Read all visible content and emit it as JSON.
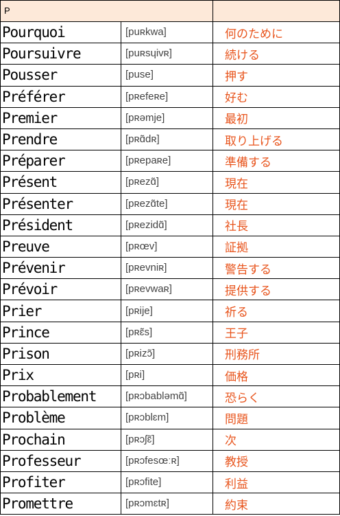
{
  "header": {
    "letter": "P"
  },
  "entries": [
    {
      "word": "Pourquoi",
      "pron": "[puʀkwa]",
      "ja": "何のために"
    },
    {
      "word": "Poursuivre",
      "pron": "[puʀsɥivʀ]",
      "ja": "続ける"
    },
    {
      "word": "Pousser",
      "pron": "[puse]",
      "ja": "押す"
    },
    {
      "word": "Préférer",
      "pron": "[pʀefeʀe]",
      "ja": "好む"
    },
    {
      "word": "Premier",
      "pron": "[pʀəmje]",
      "ja": "最初"
    },
    {
      "word": "Prendre",
      "pron": "[pʀɑ̃dʀ]",
      "ja": "取り上げる"
    },
    {
      "word": "Préparer",
      "pron": "[pʀepaʀe]",
      "ja": "準備する"
    },
    {
      "word": "Présent",
      "pron": "[pʀezɑ̃]",
      "ja": "現在"
    },
    {
      "word": "Présenter",
      "pron": "[pʀezɑ̃te]",
      "ja": "現在"
    },
    {
      "word": "Président",
      "pron": "[pʀezidɑ̃]",
      "ja": "社長"
    },
    {
      "word": "Preuve",
      "pron": "[pʀœv]",
      "ja": "証拠"
    },
    {
      "word": "Prévenir",
      "pron": "[pʀevniʀ]",
      "ja": "警告する"
    },
    {
      "word": "Prévoir",
      "pron": "[pʀevwaʀ]",
      "ja": "提供する"
    },
    {
      "word": "Prier",
      "pron": "[pʀije]",
      "ja": "祈る"
    },
    {
      "word": "Prince",
      "pron": "[pʀɛ̃s]",
      "ja": "王子"
    },
    {
      "word": "Prison",
      "pron": "[pʀizɔ̃]",
      "ja": "刑務所"
    },
    {
      "word": "Prix",
      "pron": "[pʀi]",
      "ja": "価格"
    },
    {
      "word": "Probablement",
      "pron": "[pʀɔbabləmɑ̃]",
      "ja": "恐らく"
    },
    {
      "word": "Problème",
      "pron": "[pʀɔblɛm]",
      "ja": "問題"
    },
    {
      "word": "Prochain",
      "pron": "[pʀɔʃɛ̃]",
      "ja": "次"
    },
    {
      "word": "Professeur",
      "pron": "[pʀɔfesœːʀ]",
      "ja": "教授"
    },
    {
      "word": "Profiter",
      "pron": "[pʀɔfite]",
      "ja": "利益"
    },
    {
      "word": "Promettre",
      "pron": "[pʀɔmɛtʀ]",
      "ja": "約束"
    }
  ]
}
